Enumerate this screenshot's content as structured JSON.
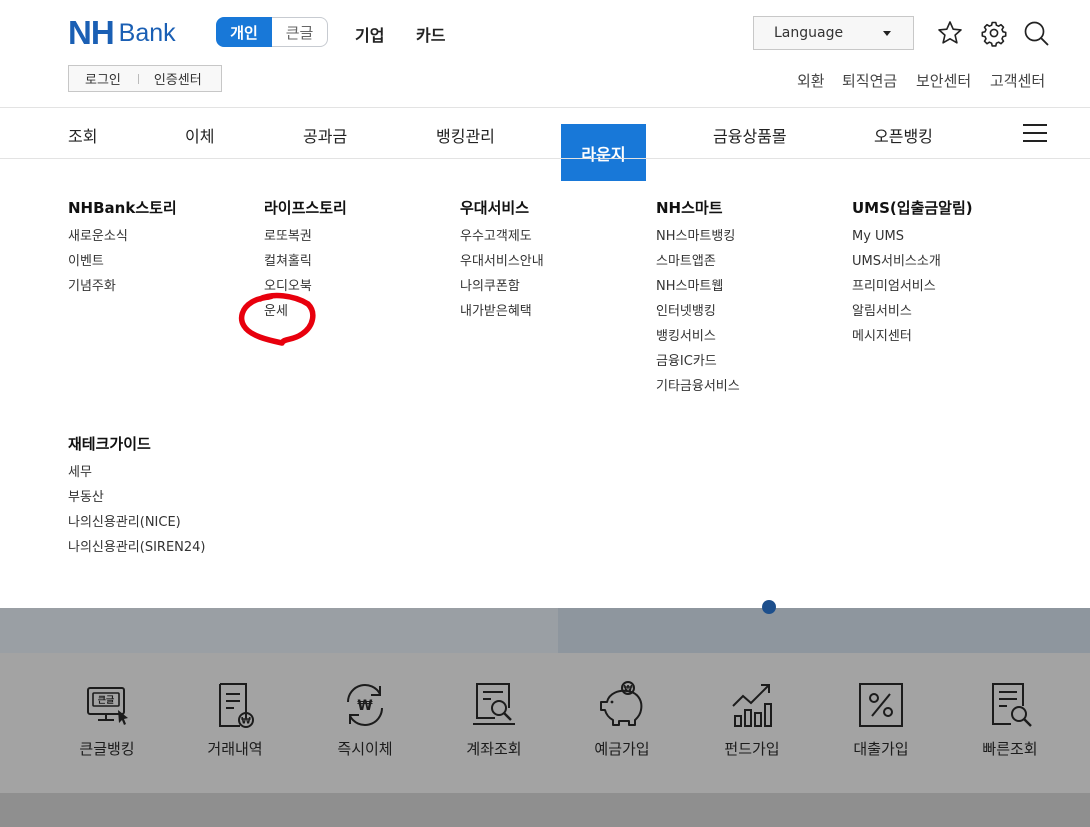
{
  "header": {
    "logo_nh": "NH",
    "logo_bank": "Bank",
    "segment": {
      "active": "개인",
      "inactive": "큰글"
    },
    "topnav": [
      "기업",
      "카드"
    ],
    "language": "Language",
    "login": "로그인",
    "cert": "인증센터",
    "util_links": [
      "외환",
      "퇴직연금",
      "보안센터",
      "고객센터"
    ],
    "icons": [
      "star-icon",
      "gear-icon",
      "search-icon"
    ]
  },
  "gnb": {
    "items": [
      "조회",
      "이체",
      "공과금",
      "뱅킹관리",
      "라운지",
      "금융상품몰",
      "오픈뱅킹"
    ],
    "active": "라운지"
  },
  "mega": {
    "columns": [
      {
        "title": "NHBank스토리",
        "items": [
          "새로운소식",
          "이벤트",
          "기념주화"
        ]
      },
      {
        "title": "라이프스토리",
        "items": [
          "로또복권",
          "컬쳐홀릭",
          "오디오북",
          "운세"
        ]
      },
      {
        "title": "우대서비스",
        "items": [
          "우수고객제도",
          "우대서비스안내",
          "나의쿠폰함",
          "내가받은혜택"
        ]
      },
      {
        "title": "NH스마트",
        "items": [
          "NH스마트뱅킹",
          "스마트앱존",
          "NH스마트웹",
          "인터넷뱅킹",
          "뱅킹서비스",
          "금융IC카드",
          "기타금융서비스"
        ]
      },
      {
        "title": "UMS(입출금알림)",
        "items": [
          "My UMS",
          "UMS서비스소개",
          "프리미엄서비스",
          "알림서비스",
          "메시지센터"
        ]
      },
      {
        "title": "재테크가이드",
        "items": [
          "세무",
          "부동산",
          "나의신용관리(NICE)",
          "나의신용관리(SIREN24)"
        ]
      }
    ]
  },
  "quick": {
    "items": [
      {
        "label": "큰글뱅킹",
        "icon": "large-text-banking-icon",
        "glyph": "큰글"
      },
      {
        "label": "거래내역",
        "icon": "transaction-history-icon"
      },
      {
        "label": "즉시이체",
        "icon": "instant-transfer-icon"
      },
      {
        "label": "계좌조회",
        "icon": "account-inquiry-icon"
      },
      {
        "label": "예금가입",
        "icon": "piggy-bank-icon"
      },
      {
        "label": "펀드가입",
        "icon": "fund-chart-icon"
      },
      {
        "label": "대출가입",
        "icon": "loan-percent-icon"
      },
      {
        "label": "빠른조회",
        "icon": "quick-inquiry-icon"
      }
    ]
  },
  "colors": {
    "brand": "#1a5fb4",
    "accent": "#1878d8",
    "annotation": "#e8000d"
  }
}
